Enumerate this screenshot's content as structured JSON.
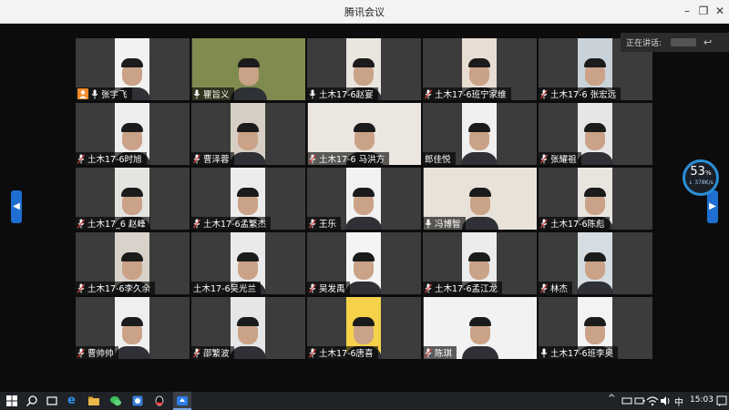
{
  "window": {
    "title": "腾讯会议",
    "min_glyph": "–",
    "restore_glyph": "❐",
    "close_glyph": "✕"
  },
  "speaking_panel": {
    "label": "正在讲话:"
  },
  "network": {
    "percent": "53",
    "unit": "%",
    "speed": "↓ 378K/s"
  },
  "tiles": [
    {
      "name": "张宇飞",
      "mic": "on",
      "host": true
    },
    {
      "name": "瞿旨义",
      "mic": "on"
    },
    {
      "name": "土木17-6赵宴",
      "mic": "on"
    },
    {
      "name": "土木17-6班宁家维",
      "mic": "muted"
    },
    {
      "name": "土木17-6 张宏远",
      "mic": "muted"
    },
    {
      "name": "土木17-6时旭",
      "mic": "muted"
    },
    {
      "name": "曹泽蓉",
      "mic": "muted"
    },
    {
      "name": "土木17-6 马洪方",
      "mic": "muted"
    },
    {
      "name": "郎佳悦",
      "mic": "none"
    },
    {
      "name": "张耀祖",
      "mic": "muted"
    },
    {
      "name": "土木17_6 赵峰",
      "mic": "muted"
    },
    {
      "name": "土木17-6孟繁杰",
      "mic": "muted"
    },
    {
      "name": "王乐",
      "mic": "muted"
    },
    {
      "name": "冯博智",
      "mic": "on"
    },
    {
      "name": "土木17-6陈彪",
      "mic": "muted"
    },
    {
      "name": "土木17-6李久余",
      "mic": "muted"
    },
    {
      "name": "土木17-6吴光兰",
      "mic": "none"
    },
    {
      "name": "吴发禹",
      "mic": "muted"
    },
    {
      "name": "土木17-6孟江龙",
      "mic": "muted"
    },
    {
      "name": "林杰",
      "mic": "muted"
    },
    {
      "name": "曹帅帅",
      "mic": "muted"
    },
    {
      "name": "邵繁波",
      "mic": "muted"
    },
    {
      "name": "土木17-6唐喜",
      "mic": "muted"
    },
    {
      "name": "陈琪",
      "mic": "muted"
    },
    {
      "name": "土木17-6班李奥",
      "mic": "on"
    }
  ],
  "taskbar": {
    "ime": "中",
    "clock": "15:03"
  },
  "colors": {
    "host_badge": "#f28b2a",
    "nav_button": "#1e6fd1",
    "gauge_ring": "#2a8fd8",
    "muted_mic": "#e04040"
  }
}
